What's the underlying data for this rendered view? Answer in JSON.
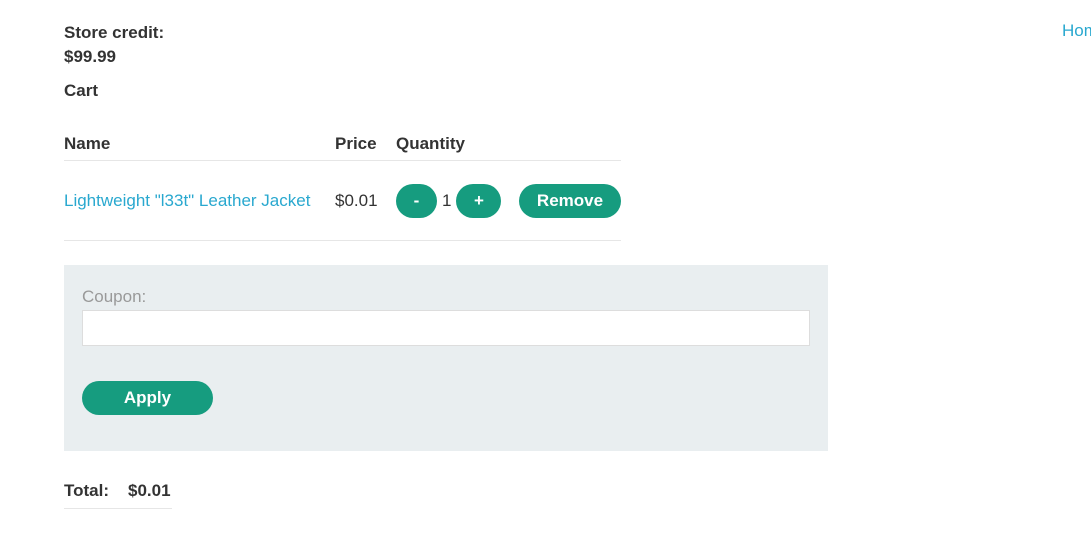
{
  "nav": {
    "home_label": "Home"
  },
  "account": {
    "store_credit_label": "Store credit:",
    "store_credit_value": "$99.99"
  },
  "cart": {
    "heading": "Cart",
    "columns": [
      "Name",
      "Price",
      "Quantity"
    ],
    "items": [
      {
        "name": "Lightweight \"l33t\" Leather Jacket",
        "price": "$0.01",
        "quantity": "1",
        "decrement_label": "-",
        "increment_label": "+",
        "remove_label": "Remove"
      }
    ]
  },
  "coupon": {
    "label": "Coupon:",
    "value": "",
    "placeholder": "",
    "apply_label": "Apply"
  },
  "total": {
    "label": "Total:",
    "value": "$0.01"
  },
  "colors": {
    "accent": "#169c7f",
    "link": "#29a8cf",
    "panel": "#e9eef0"
  }
}
